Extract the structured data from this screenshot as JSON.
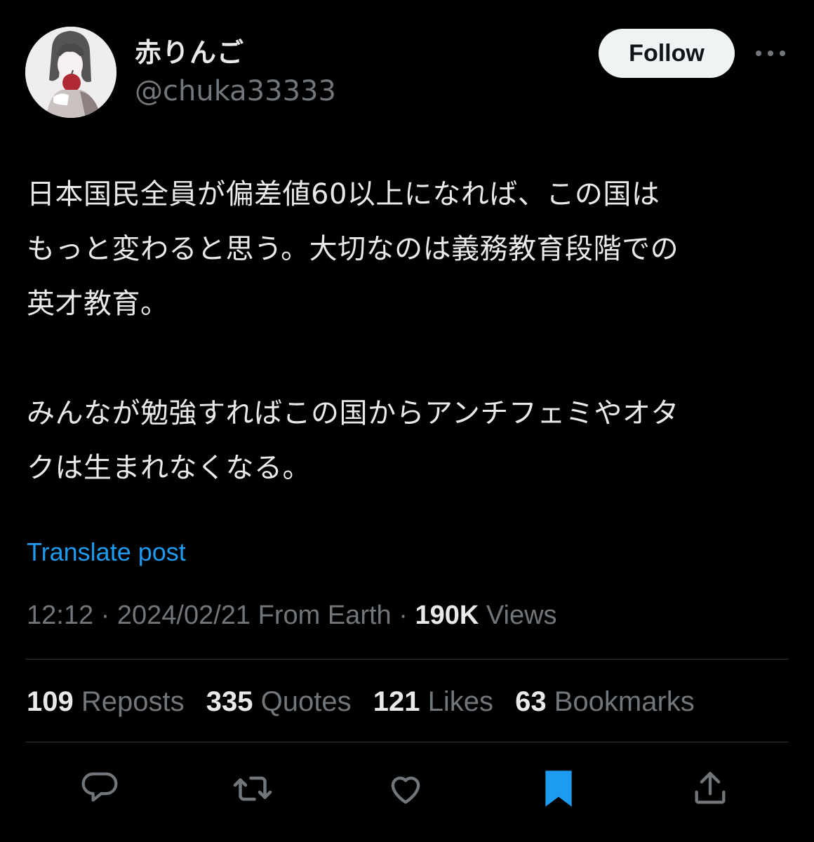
{
  "author": {
    "display_name": "赤りんご",
    "handle": "@chuka33333"
  },
  "follow_button": {
    "label": "Follow"
  },
  "post": {
    "paragraph1": "日本国民全員が偏差値60以上になれば、この国は\nもっと変わると思う。大切なのは義務教育段階での\n英才教育。",
    "paragraph2": "みんなが勉強すればこの国からアンチフェミやオタ\nクは生まれなくなる。",
    "translate_label": "Translate post"
  },
  "meta": {
    "time": "12:12",
    "separator": " · ",
    "date": "2024/02/21",
    "source": "From Earth",
    "views_count": "190K",
    "views_label": "Views"
  },
  "stats": {
    "reposts": {
      "count": "109",
      "label": "Reposts"
    },
    "quotes": {
      "count": "335",
      "label": "Quotes"
    },
    "likes": {
      "count": "121",
      "label": "Likes"
    },
    "bookmarks": {
      "count": "63",
      "label": "Bookmarks"
    }
  },
  "actions": [
    {
      "icon": "reply-icon"
    },
    {
      "icon": "repost-icon"
    },
    {
      "icon": "like-icon"
    },
    {
      "icon": "bookmark-icon",
      "active": true
    },
    {
      "icon": "share-icon"
    }
  ],
  "colors": {
    "background": "#000000",
    "text": "#e7e9ea",
    "secondary": "#71767b",
    "link": "#1d9bf0",
    "bookmark_active": "#1d9bf0",
    "divider": "#2f3336"
  }
}
